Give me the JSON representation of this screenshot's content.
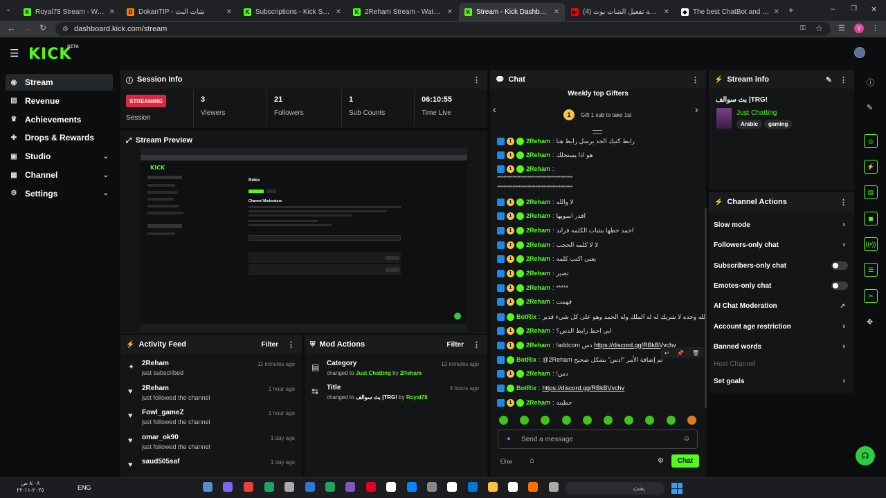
{
  "browser": {
    "tabs": [
      {
        "title": "Royal78 Stream - Watch Live o",
        "fav": "K",
        "color": "#53fc18"
      },
      {
        "title": "DokanTIP - شات البث",
        "fav": "D",
        "color": "#ff7b00"
      },
      {
        "title": "Subscriptions - Kick Streaming",
        "fav": "K",
        "color": "#53fc18"
      },
      {
        "title": "2Reham Stream - Watch Live o",
        "fav": "K",
        "color": "#53fc18"
      },
      {
        "title": "Stream - Kick Dashboard",
        "fav": "K",
        "color": "#53fc18"
      },
      {
        "title": "(4) شرح طريقة تفعيل الشات بوت",
        "fav": "▶",
        "color": "#ff0000"
      },
      {
        "title": "The best ChatBot and Widgets",
        "fav": "◆",
        "color": "#ffffff"
      }
    ],
    "url": "dashboard.kick.com/stream",
    "profile_initial": "Y"
  },
  "kick": {
    "logo": "KICK",
    "beta": "BETA"
  },
  "sidebar": {
    "items": [
      {
        "label": "Stream",
        "icon": "stream-icon",
        "active": true
      },
      {
        "label": "Revenue",
        "icon": "revenue-icon"
      },
      {
        "label": "Achievements",
        "icon": "trophy-icon"
      },
      {
        "label": "Drops & Rewards",
        "icon": "gift-icon"
      },
      {
        "label": "Studio",
        "icon": "studio-icon",
        "chev": "⌄"
      },
      {
        "label": "Channel",
        "icon": "channel-icon",
        "chev": "⌄"
      },
      {
        "label": "Settings",
        "icon": "gear-icon",
        "chev": "⌄"
      }
    ]
  },
  "session": {
    "title": "Session Info",
    "badge": "STREAMING",
    "session_label": "Session",
    "stats": [
      {
        "value": "3",
        "label": "Viewers"
      },
      {
        "value": "21",
        "label": "Followers"
      },
      {
        "value": "1",
        "label": "Sub Counts"
      },
      {
        "value": "06:10:55",
        "label": "Time Live"
      }
    ]
  },
  "preview": {
    "title": "Stream Preview",
    "inner_title": "Roles",
    "inner_heading": "Channel Moderators"
  },
  "activity": {
    "title": "Activity Feed",
    "filter": "Filter",
    "items": [
      {
        "name": "2Reham",
        "sub": "just subscribed",
        "time": "11 minutes ago",
        "icon": "sub-icon"
      },
      {
        "name": "2Reham",
        "sub": "just followed the channel",
        "time": "1 hour ago",
        "icon": "heart-icon"
      },
      {
        "name": "Fowl_gameZ",
        "sub": "just followed the channel",
        "time": "1 hour ago",
        "icon": "heart-icon"
      },
      {
        "name": "omar_ok90",
        "sub": "just followed the channel",
        "time": "1 day ago",
        "icon": "heart-icon"
      },
      {
        "name": "saud505saf",
        "sub": "",
        "time": "1 day ago",
        "icon": "heart-icon"
      }
    ]
  },
  "mod": {
    "title": "Mod Actions",
    "filter": "Filter",
    "items": [
      {
        "title": "Category",
        "time": "12 minutes ago",
        "pre": "changed to",
        "value": "Just Chatting",
        "by": "by",
        "user": "2Reham"
      },
      {
        "title": "Title",
        "time": "4 hours ago",
        "pre": "changed to",
        "value": "بث سوالف |TRG!",
        "by": "by",
        "user": "Royal78"
      }
    ]
  },
  "chat": {
    "title": "Chat",
    "gifters_title": "Weekly top Gifters",
    "gifters_sub": "Gift 1 sub to take 1st",
    "messages": [
      {
        "user": "2Reham",
        "msg": "رابط كتيك الحد يرسل رابط هنا",
        "bot": false
      },
      {
        "user": "2Reham",
        "msg": "هو اذا يستحلك",
        "bot": false
      },
      {
        "user": "2Reham",
        "msg": "",
        "bot": false
      },
      {
        "user": "2Reham",
        "msg": "لا والله",
        "bot": false
      },
      {
        "user": "2Reham",
        "msg": "اقدر اسويها",
        "bot": false
      },
      {
        "user": "2Reham",
        "msg": "احمد حطها بشات الكلمه فراند",
        "bot": false
      },
      {
        "user": "2Reham",
        "msg": "لا لا كلمه الحجب",
        "bot": false
      },
      {
        "user": "2Reham",
        "msg": "يعني اكتب كلمه",
        "bot": false
      },
      {
        "user": "2Reham",
        "msg": "تصير",
        "bot": false
      },
      {
        "user": "2Reham",
        "msg": "*****",
        "bot": false
      },
      {
        "user": "2Reham",
        "msg": "فهمت",
        "bot": false
      },
      {
        "user": "BotRix",
        "msg": "لا إله إلا الله وحده لا شريك له له الملك وله الحمد وهو على كل شيء قدير\"",
        "bot": true
      },
      {
        "user": "2Reham",
        "msg": "ابي احط رابط الدس؟",
        "bot": false
      },
      {
        "user": "2Reham",
        "msg": "!addcom دس",
        "link": "https://discord.gg/RBkBVvchv",
        "bot": false
      },
      {
        "user": "BotRix",
        "msg": "@2Reham تم إضافة الأمر \"!دس\" بشكل صحيح",
        "bot": true
      },
      {
        "user": "2Reham",
        "msg": "!دس",
        "bot": false
      },
      {
        "user": "BotRix",
        "msg": "",
        "link": "https://discord.gg/RBkBVvchv",
        "bot": true
      },
      {
        "user": "2Reham",
        "msg": "حطيته",
        "bot": false
      }
    ],
    "wrap_line": "*************************************************",
    "input_placeholder": "Send a message",
    "send": "Chat"
  },
  "stream_info": {
    "title": "Stream info",
    "stream_title": "بث سوالف |TRG!",
    "category": "Just Chatting",
    "tags": [
      "Arabic",
      "gaming"
    ]
  },
  "channel_actions": {
    "title": "Channel Actions",
    "items": [
      {
        "label": "Slow mode",
        "kind": "arrow"
      },
      {
        "label": "Followers-only chat",
        "kind": "arrow"
      },
      {
        "label": "Subscribers-only chat",
        "kind": "toggle"
      },
      {
        "label": "Emotes-only chat",
        "kind": "toggle"
      },
      {
        "label": "AI Chat Moderation",
        "kind": "ext"
      },
      {
        "label": "Account age restriction",
        "kind": "arrow"
      },
      {
        "label": "Banned words",
        "kind": "arrow"
      },
      {
        "label": "Host Channel",
        "kind": "none",
        "disabled": true
      },
      {
        "label": "Set goals",
        "kind": "arrow"
      }
    ]
  },
  "taskbar": {
    "lang": "ENG",
    "date": "٢٠٢٥-١١-٢٢",
    "time": "٨:٠٨ ص",
    "search": "بحث"
  }
}
